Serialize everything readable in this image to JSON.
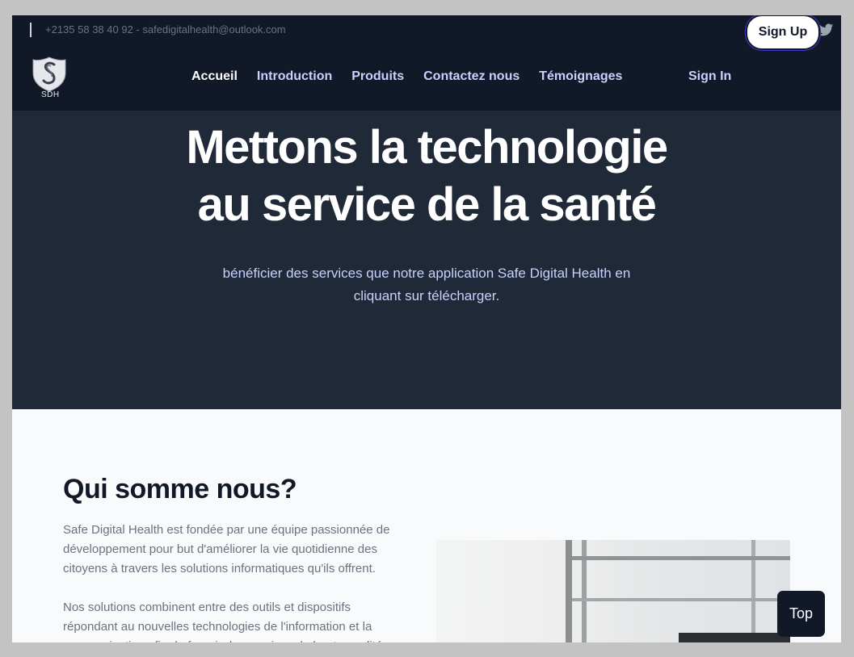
{
  "topbar": {
    "contact": "+2135 58 38 40 92 - safedigitalhealth@outlook.com",
    "social": [
      "facebook-icon",
      "instagram-icon",
      "twitter-icon"
    ]
  },
  "brand": {
    "logo_text": "SDH"
  },
  "nav": {
    "items": [
      {
        "label": "Accueil",
        "active": true
      },
      {
        "label": "Introduction"
      },
      {
        "label": "Produits"
      },
      {
        "label": "Contactez nous"
      },
      {
        "label": "Témoignages"
      }
    ],
    "signin": "Sign In",
    "signup": "Sign Up"
  },
  "hero": {
    "title_line1": "Mettons la technologie",
    "title_line2": "au service de la santé",
    "subtitle": "bénéficier des services que notre application Safe Digital Health en cliquant sur télécharger."
  },
  "about": {
    "heading": "Qui somme nous?",
    "para1": "Safe Digital Health est fondée par une équipe passionnée de développement pour but d'améliorer la vie quotidienne des citoyens à travers les solutions informatiques qu'ils offrent.",
    "para2": "Nos solutions combinent entre des outils et dispositifs répondant au nouvelles technologies de l'information et la communication afin de fournir des services de haute qualité"
  },
  "scroll_top": "Top",
  "colors": {
    "dark": "#111827",
    "hero": "#1f2937",
    "accent": "#c7d2fe"
  }
}
